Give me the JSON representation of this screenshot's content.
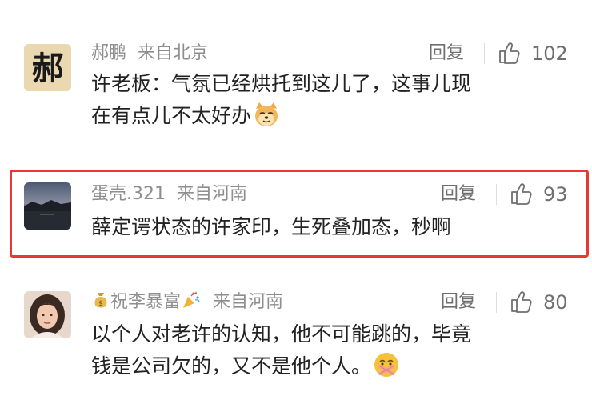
{
  "comments": [
    {
      "username": "郝鹏",
      "location": "来自北京",
      "reply_label": "回复",
      "likes": "102",
      "avatar_char": "郝",
      "text_line1": "许老板：气氛已经烘托到这儿了，这事儿现",
      "text_line2": "在有点儿不太好办"
    },
    {
      "username": "蛋壳.321",
      "location": "来自河南",
      "reply_label": "回复",
      "likes": "93",
      "text_line1": "薛定谔状态的许家印，生死叠加态，秒啊"
    },
    {
      "username_prefix_icon": "money-bag-icon",
      "username": "祝李暴富",
      "username_suffix_icon": "party-popper-icon",
      "location": "来自河南",
      "reply_label": "回复",
      "likes": "80",
      "text_line1": "以个人对老许的认知，他不可能跳的，毕竟",
      "text_line2": "钱是公司欠的，又不是他个人。"
    }
  ],
  "colors": {
    "highlight": "#e53935",
    "meta": "#8e8e8e",
    "text": "#222222"
  }
}
